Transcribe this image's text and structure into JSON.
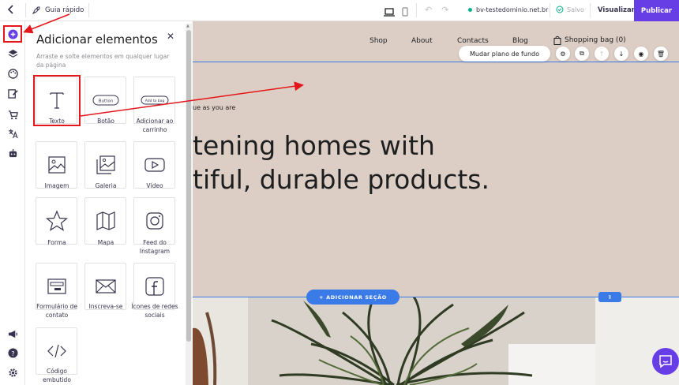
{
  "topbar": {
    "guide_label": "Guia rápido",
    "domain": "bv-testedominio.net.br",
    "saved_label": "Salvo",
    "visualize_label": "Visualizar",
    "publish_label": "Publicar"
  },
  "panel": {
    "title": "Adicionar elementos",
    "subtitle": "Arraste e solte elementos em qualquer lugar da página",
    "elements": [
      {
        "label": "Texto",
        "icon": "text-icon"
      },
      {
        "label": "Botão",
        "icon": "button-icon",
        "preview": "Button"
      },
      {
        "label": "Adicionar ao carrinho",
        "icon": "add-to-bag-icon",
        "preview": "Add to bag"
      },
      {
        "label": "Imagem",
        "icon": "image-icon"
      },
      {
        "label": "Galeria",
        "icon": "gallery-icon"
      },
      {
        "label": "Vídeo",
        "icon": "video-icon"
      },
      {
        "label": "Forma",
        "icon": "star-shape-icon"
      },
      {
        "label": "Mapa",
        "icon": "map-icon"
      },
      {
        "label": "Feed do Instagram",
        "icon": "instagram-icon"
      },
      {
        "label": "Formulário de contato",
        "icon": "form-icon"
      },
      {
        "label": "Inscreva-se",
        "icon": "envelope-icon"
      },
      {
        "label": "Ícones de redes sociais",
        "icon": "facebook-icon"
      },
      {
        "label": "Código embutido",
        "icon": "code-icon"
      }
    ]
  },
  "site": {
    "nav": [
      "Shop",
      "About",
      "Contacts",
      "Blog"
    ],
    "bag_label": "Shopping bag (0)",
    "change_bg_label": "Mudar plano de fundo",
    "kicker": "ue as you are",
    "hero_line1": "tening homes with",
    "hero_line2": "tiful, durable products.",
    "add_section_label": "+ ADICIONAR SEÇÃO"
  },
  "colors": {
    "accent": "#673de6",
    "selection": "#3a7be8",
    "annotation": "#e4161b",
    "hero_bg": "#ddcec5"
  }
}
